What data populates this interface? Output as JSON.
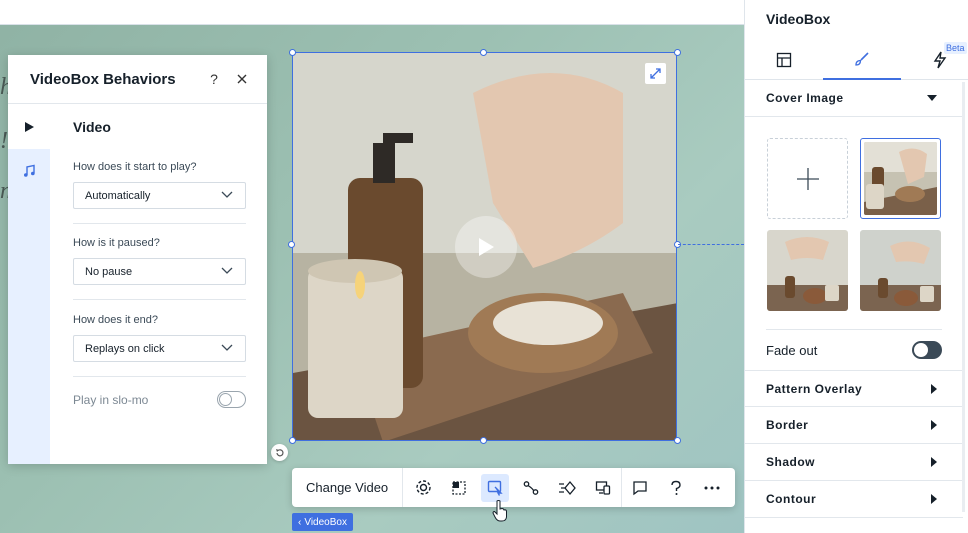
{
  "behaviors_panel": {
    "title": "VideoBox Behaviors",
    "help_icon": "?",
    "section_title": "Video",
    "tabs": [
      {
        "icon": "play-icon"
      },
      {
        "icon": "music-note-icon"
      }
    ],
    "questions": [
      {
        "label": "How does it start to play?",
        "value": "Automatically"
      },
      {
        "label": "How is it paused?",
        "value": "No pause"
      },
      {
        "label": "How does it end?",
        "value": "Replays on click"
      }
    ],
    "slo_mo_label": "Play in slo-mo",
    "slo_mo_on": false
  },
  "toolbar": {
    "change_video_label": "Change Video"
  },
  "element_tag": "VideoBox",
  "right_panel": {
    "title": "VideoBox",
    "beta_badge": "Beta",
    "accent_color": "#3f6fe0",
    "sections": {
      "cover_image": "Cover Image",
      "fade_out": "Fade out",
      "pattern_overlay": "Pattern Overlay",
      "border": "Border",
      "shadow": "Shadow",
      "contour": "Contour"
    },
    "fade_out_on": true
  }
}
